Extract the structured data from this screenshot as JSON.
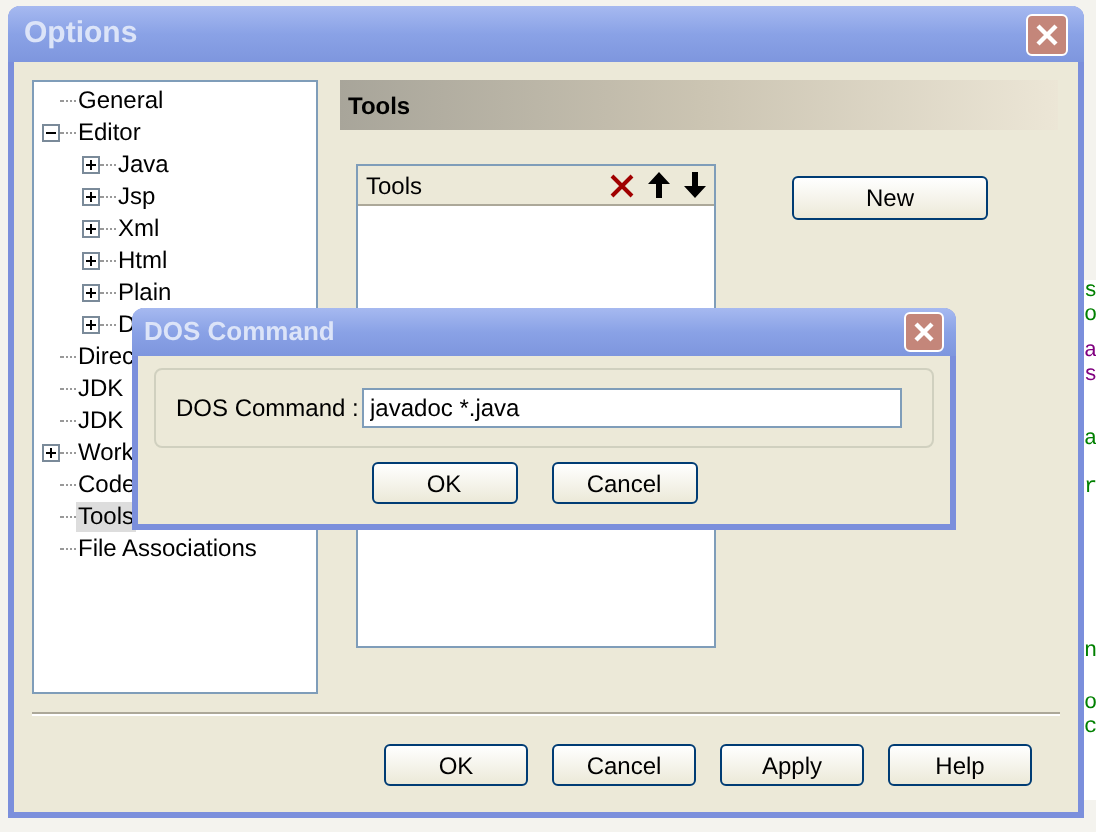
{
  "window": {
    "title": "Options"
  },
  "tree": [
    {
      "label": "General",
      "selected": false
    },
    {
      "label": "Editor",
      "selected": false,
      "expanded": true,
      "children": [
        {
          "label": "Java",
          "selected": false,
          "expanded": false
        },
        {
          "label": "Jsp",
          "selected": false,
          "expanded": false
        },
        {
          "label": "Xml",
          "selected": false,
          "expanded": false
        },
        {
          "label": "Html",
          "selected": false,
          "expanded": false
        },
        {
          "label": "Plain",
          "selected": false,
          "expanded": false
        },
        {
          "label": "D",
          "selected": false,
          "expanded": false
        }
      ]
    },
    {
      "label": "Direc",
      "selected": false
    },
    {
      "label": "JDK",
      "selected": false
    },
    {
      "label": "JDK",
      "selected": false
    },
    {
      "label": "Work",
      "selected": false,
      "expanded": false
    },
    {
      "label": "Code",
      "selected": false
    },
    {
      "label": "Tools",
      "selected": true
    },
    {
      "label": "File Associations",
      "selected": false
    }
  ],
  "panel": {
    "title": "Tools",
    "list": {
      "header": "Tools"
    },
    "new_button": "New"
  },
  "buttons": [
    "OK",
    "Cancel",
    "Apply",
    "Help"
  ],
  "dialog": {
    "title": "DOS Command",
    "label": "DOS Command :",
    "value": "javadoc *.java",
    "buttons": [
      "OK",
      "Cancel"
    ]
  },
  "background_code": [
    {
      "text": "s",
      "color": "#008000"
    },
    {
      "text": "o",
      "color": "#008000"
    },
    {
      "text": "a",
      "color": "#800080"
    },
    {
      "text": "s",
      "color": "#800080"
    },
    {
      "text": "a",
      "color": "#008000"
    },
    {
      "text": "r",
      "color": "#008000"
    },
    {
      "text": "n",
      "color": "#008000"
    },
    {
      "text": "o",
      "color": "#008000"
    },
    {
      "text": "c",
      "color": "#008000"
    }
  ]
}
